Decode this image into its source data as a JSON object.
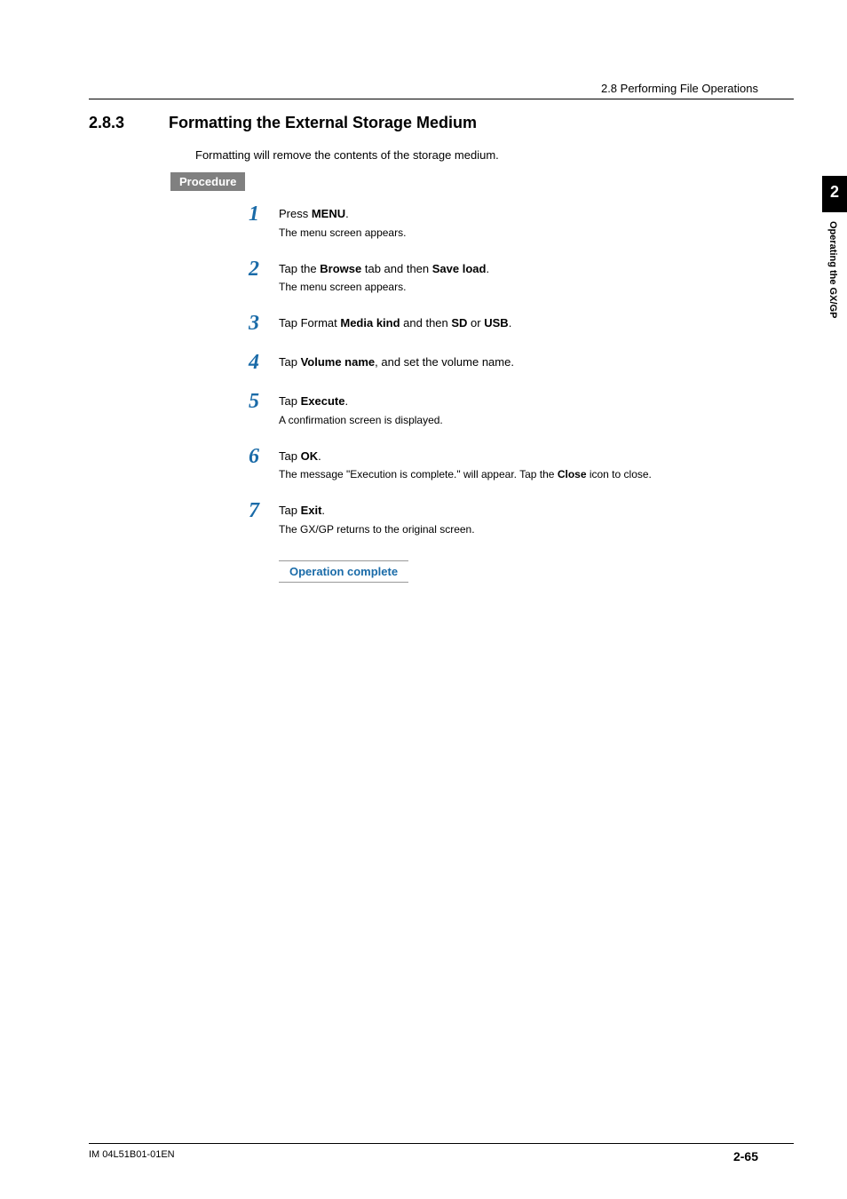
{
  "header": {
    "breadcrumb": "2.8  Performing File Operations"
  },
  "section": {
    "number": "2.8.3",
    "title": "Formatting the External Storage Medium",
    "intro": "Formatting will remove the contents of the storage medium.",
    "procedure_label": "Procedure"
  },
  "steps": [
    {
      "num": "1",
      "segments": [
        {
          "t": "Press ",
          "b": false
        },
        {
          "t": "MENU",
          "b": true
        },
        {
          "t": ".",
          "b": false
        }
      ],
      "sub": "The menu screen appears."
    },
    {
      "num": "2",
      "segments": [
        {
          "t": "Tap the ",
          "b": false
        },
        {
          "t": "Browse",
          "b": true
        },
        {
          "t": " tab and then ",
          "b": false
        },
        {
          "t": "Save load",
          "b": true
        },
        {
          "t": ".",
          "b": false
        }
      ],
      "sub": "The menu screen appears."
    },
    {
      "num": "3",
      "segments": [
        {
          "t": "Tap Format ",
          "b": false
        },
        {
          "t": "Media kind",
          "b": true
        },
        {
          "t": " and then ",
          "b": false
        },
        {
          "t": "SD",
          "b": true
        },
        {
          "t": " or ",
          "b": false
        },
        {
          "t": "USB",
          "b": true
        },
        {
          "t": ".",
          "b": false
        }
      ],
      "sub": ""
    },
    {
      "num": "4",
      "segments": [
        {
          "t": "Tap ",
          "b": false
        },
        {
          "t": "Volume name",
          "b": true
        },
        {
          "t": ", and set the volume name.",
          "b": false
        }
      ],
      "sub": ""
    },
    {
      "num": "5",
      "segments": [
        {
          "t": "Tap ",
          "b": false
        },
        {
          "t": "Execute",
          "b": true
        },
        {
          "t": ".",
          "b": false
        }
      ],
      "sub": "A confirmation screen is displayed."
    },
    {
      "num": "6",
      "segments": [
        {
          "t": "Tap ",
          "b": false
        },
        {
          "t": "OK",
          "b": true
        },
        {
          "t": ".",
          "b": false
        }
      ],
      "sub_segments": [
        {
          "t": "The message \"Execution is complete.\" will appear. Tap the ",
          "b": false
        },
        {
          "t": "Close",
          "b": true
        },
        {
          "t": " icon to close.",
          "b": false
        }
      ]
    },
    {
      "num": "7",
      "segments": [
        {
          "t": "Tap ",
          "b": false
        },
        {
          "t": "Exit",
          "b": true
        },
        {
          "t": ".",
          "b": false
        }
      ],
      "sub": "The GX/GP returns to the original screen."
    }
  ],
  "operation_complete": "Operation complete",
  "sidetab": {
    "chapter": "2",
    "title": "Operating the GX/GP"
  },
  "footer": {
    "doc_id": "IM 04L51B01-01EN",
    "page": "2-65"
  }
}
